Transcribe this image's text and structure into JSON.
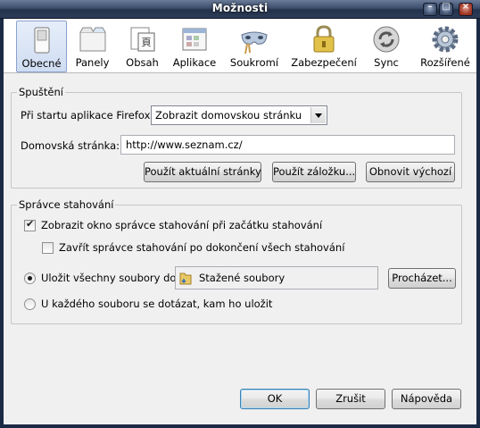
{
  "window": {
    "title": "Možnosti",
    "minimize": "–",
    "maximize": "□",
    "close": "×"
  },
  "toolbar": {
    "items": [
      {
        "label": "Obecné",
        "icon": "switch-icon"
      },
      {
        "label": "Panely",
        "icon": "tabs-icon"
      },
      {
        "label": "Obsah",
        "icon": "content-icon"
      },
      {
        "label": "Aplikace",
        "icon": "applications-icon"
      },
      {
        "label": "Soukromí",
        "icon": "mask-icon"
      },
      {
        "label": "Zabezpečení",
        "icon": "padlock-icon"
      },
      {
        "label": "Sync",
        "icon": "sync-icon"
      },
      {
        "label": "Rozšířené",
        "icon": "gear-icon"
      }
    ],
    "selected": "Obecné"
  },
  "startup": {
    "legend": "Spuštění",
    "when_label": "Při startu aplikace Firefox:",
    "when_value": "Zobrazit domovskou stránku",
    "home_label": "Domovská stránka:",
    "home_value": "http://www.seznam.cz/",
    "btn_current": "Použít aktuální stránky",
    "btn_bookmark": "Použít záložku...",
    "btn_default": "Obnovit výchozí"
  },
  "downloads": {
    "legend": "Správce stahování",
    "show_label": "Zobrazit okno správce stahování při začátku stahování",
    "show_checked": true,
    "close_label": "Zavřít správce stahování po dokončení všech stahování",
    "close_checked": false,
    "save_label": "Uložit všechny soubory do",
    "save_selected": true,
    "folder": "Stažené soubory",
    "browse": "Procházet...",
    "ask_label": "U každého souboru se dotázat, kam ho uložit",
    "ask_selected": false
  },
  "buttons": {
    "ok": "OK",
    "cancel": "Zrušit",
    "help": "Nápověda"
  },
  "colors": {
    "titlebar": "#2c3c58",
    "selected_tab": "#cfdcf1",
    "dialog_bg": "#f0f0f0"
  }
}
